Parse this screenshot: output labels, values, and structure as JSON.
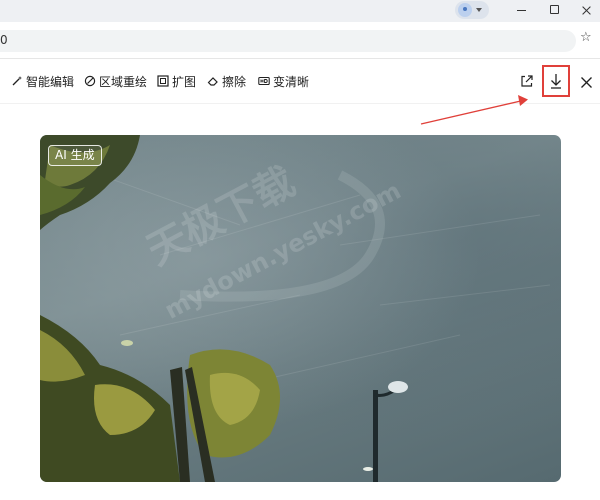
{
  "browser": {
    "url_text": "0"
  },
  "toolbar": {
    "smart_edit": "智能编辑",
    "region_redraw": "区域重绘",
    "expand": "扩图",
    "erase": "擦除",
    "clarify": "变清晰"
  },
  "image": {
    "badge": "AI 生成",
    "watermark_cn": "天极下载",
    "watermark_url": "mydown.yesky.com"
  },
  "colors": {
    "highlight_red": "#e0403a",
    "accent_blue": "#4a78c0"
  },
  "icons": {
    "profile": "avatar-icon",
    "bookmark": "star-icon",
    "share": "share-icon",
    "download": "download-icon",
    "close": "close-icon"
  }
}
